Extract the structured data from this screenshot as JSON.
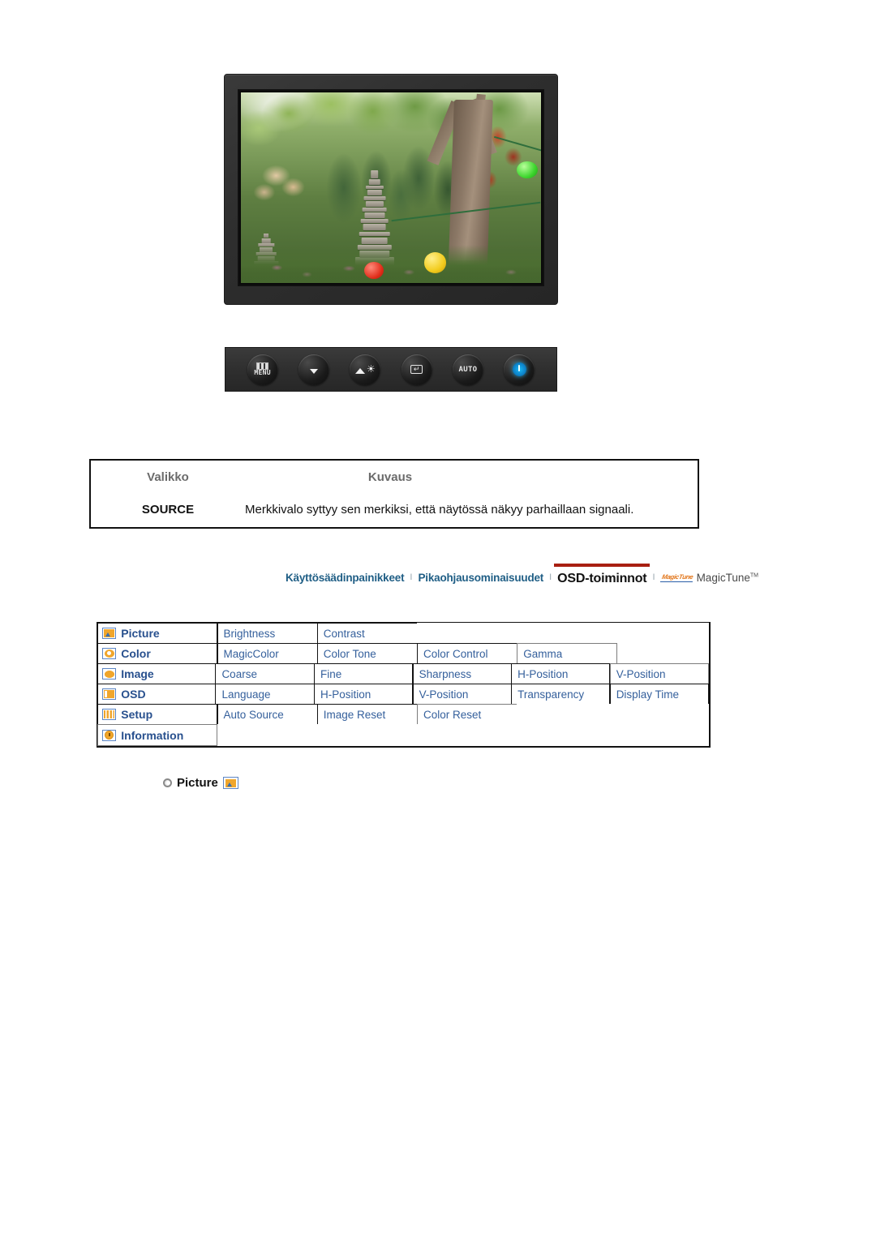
{
  "monitor": {
    "photo_alt": "garden-scene-with-stone-pagoda",
    "buttons": [
      {
        "name": "menu-button",
        "label": "MENU",
        "icon": "menu-bars-icon"
      },
      {
        "name": "source-down-button",
        "label": "",
        "icon": "source-down-icon"
      },
      {
        "name": "brightness-button",
        "label": "",
        "icon": "brightness-sun-icon"
      },
      {
        "name": "enter-button",
        "label": "",
        "icon": "enter-icon"
      },
      {
        "name": "auto-button",
        "label": "AUTO",
        "icon": "auto-text-icon"
      },
      {
        "name": "power-button",
        "label": "",
        "icon": "power-icon"
      }
    ]
  },
  "desc_table": {
    "header": {
      "menu": "Valikko",
      "description": "Kuvaus"
    },
    "rows": [
      {
        "menu": "SOURCE",
        "description": "Merkkivalo syttyy sen merkiksi, että näytössä näkyy parhaillaan signaali."
      }
    ]
  },
  "nav": {
    "tabs": [
      {
        "label": "Käyttösäädinpainikkeet",
        "active": false
      },
      {
        "label": "Pikaohjausominaisuudet",
        "active": false
      },
      {
        "label": "OSD-toiminnot",
        "active": true
      },
      {
        "label": "MagicTune",
        "active": false,
        "logo": "magictune-logo",
        "tm": "TM"
      }
    ],
    "separator": "I",
    "active_underline_color": "#a81f11"
  },
  "osd_table": {
    "rows": [
      {
        "icon": "picture-icon",
        "group": "Picture",
        "items": [
          "Brightness",
          "Contrast"
        ]
      },
      {
        "icon": "color-icon",
        "group": "Color",
        "items": [
          "MagicColor",
          "Color Tone",
          "Color Control",
          "Gamma"
        ]
      },
      {
        "icon": "image-icon",
        "group": "Image",
        "items": [
          "Coarse",
          "Fine",
          "Sharpness",
          "H-Position",
          "V-Position"
        ]
      },
      {
        "icon": "osd-icon",
        "group": "OSD",
        "items": [
          "Language",
          "H-Position",
          "V-Position",
          "Transparency",
          "Display Time"
        ]
      },
      {
        "icon": "setup-icon",
        "group": "Setup",
        "items": [
          "Auto Source",
          "Image Reset",
          "Color Reset"
        ]
      },
      {
        "icon": "information-icon",
        "group": "Information",
        "items": []
      }
    ],
    "link_color": "#35609c",
    "group_color": "#28508e"
  },
  "section": {
    "heading": "Picture",
    "heading_icon": "picture-icon",
    "bullet": "circle-bullet"
  }
}
